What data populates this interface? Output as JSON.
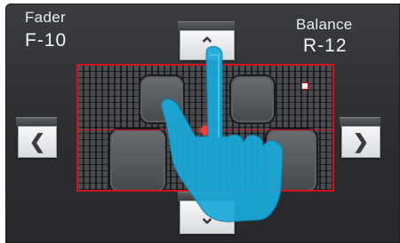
{
  "fader": {
    "label": "Fader",
    "value": "F-10"
  },
  "balance": {
    "label": "Balance",
    "value": "R-12"
  },
  "buttons": {
    "up": {
      "icon": "chevron-up-icon",
      "glyph": "⌃"
    },
    "down": {
      "icon": "chevron-down-icon",
      "glyph": "⌄"
    },
    "left": {
      "icon": "chevron-left-icon",
      "glyph": "❮"
    },
    "right": {
      "icon": "chevron-right-icon",
      "glyph": "❯"
    }
  },
  "colors": {
    "accent": "#d0141f",
    "hand": "#1aa9d9",
    "background": "#2f3134"
  }
}
